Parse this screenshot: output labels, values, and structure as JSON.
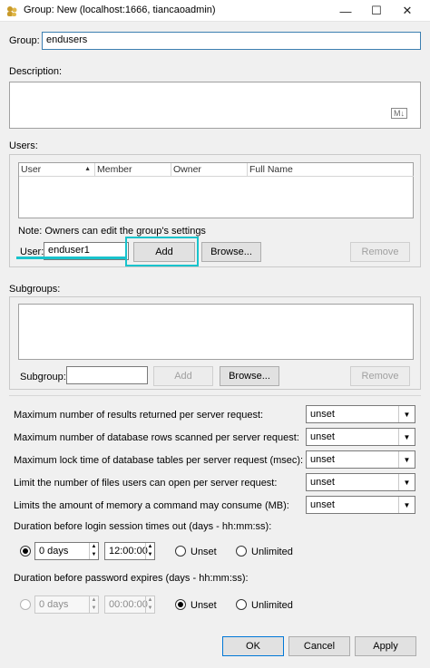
{
  "window": {
    "title": "Group: New (localhost:1666,  tiancaoadmin)",
    "minimize": "—",
    "maximize": "☐",
    "close": "✕"
  },
  "group": {
    "label": "Group:",
    "value": "endusers"
  },
  "description": {
    "label": "Description:",
    "badge": "M↓"
  },
  "users": {
    "label": "Users:",
    "columns": [
      "User",
      "Member",
      "Owner",
      "Full Name"
    ],
    "sort_indicator": "▲",
    "note": "Note: Owners can edit the group's settings",
    "user_label": "User:",
    "user_value": "enduser1",
    "add": "Add",
    "browse": "Browse...",
    "remove": "Remove"
  },
  "subgroups": {
    "label": "Subgroups:",
    "subgroup_label": "Subgroup:",
    "subgroup_value": "",
    "add": "Add",
    "browse": "Browse...",
    "remove": "Remove"
  },
  "limits": [
    {
      "label": "Maximum number of results returned per server request:",
      "value": "unset"
    },
    {
      "label": "Maximum number of database rows scanned per server request:",
      "value": "unset"
    },
    {
      "label": "Maximum lock time of database tables per server request (msec):",
      "value": "unset"
    },
    {
      "label": "Limit the number of files users can open per server request:",
      "value": "unset"
    },
    {
      "label": "Limits the amount of memory a command may consume (MB):",
      "value": "unset"
    }
  ],
  "session_timeout": {
    "label": "Duration before login session times out (days - hh:mm:ss):",
    "days": "0 days",
    "time": "12:00:00",
    "unset": "Unset",
    "unlimited": "Unlimited"
  },
  "password_expire": {
    "label": "Duration before password expires (days - hh:mm:ss):",
    "days": "0 days",
    "time": "00:00:00",
    "unset": "Unset",
    "unlimited": "Unlimited"
  },
  "footer": {
    "ok": "OK",
    "cancel": "Cancel",
    "apply": "Apply"
  },
  "colors": {
    "highlight": "#18c3cc",
    "focus_border": "#3c7fb1"
  }
}
